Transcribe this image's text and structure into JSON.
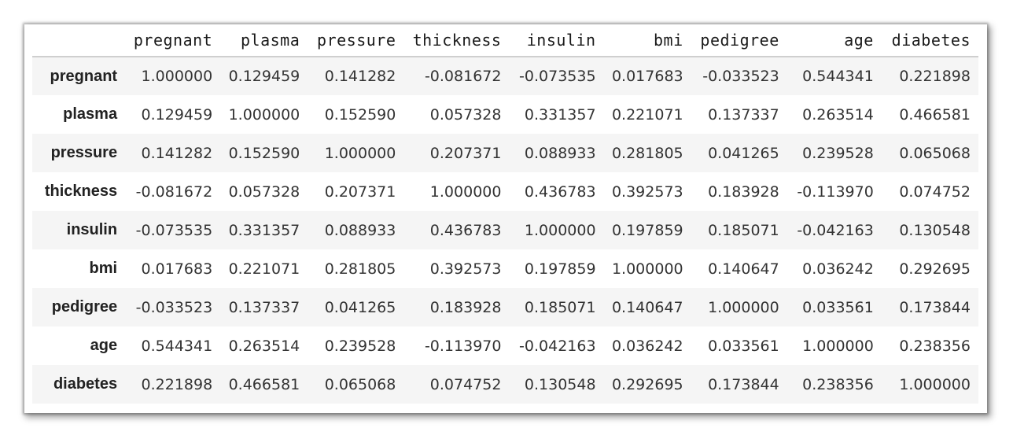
{
  "table": {
    "columns": [
      "pregnant",
      "plasma",
      "pressure",
      "thickness",
      "insulin",
      "bmi",
      "pedigree",
      "age",
      "diabetes"
    ],
    "rows": [
      {
        "label": "pregnant",
        "values": [
          "1.000000",
          "0.129459",
          "0.141282",
          "-0.081672",
          "-0.073535",
          "0.017683",
          "-0.033523",
          "0.544341",
          "0.221898"
        ]
      },
      {
        "label": "plasma",
        "values": [
          "0.129459",
          "1.000000",
          "0.152590",
          "0.057328",
          "0.331357",
          "0.221071",
          "0.137337",
          "0.263514",
          "0.466581"
        ]
      },
      {
        "label": "pressure",
        "values": [
          "0.141282",
          "0.152590",
          "1.000000",
          "0.207371",
          "0.088933",
          "0.281805",
          "0.041265",
          "0.239528",
          "0.065068"
        ]
      },
      {
        "label": "thickness",
        "values": [
          "-0.081672",
          "0.057328",
          "0.207371",
          "1.000000",
          "0.436783",
          "0.392573",
          "0.183928",
          "-0.113970",
          "0.074752"
        ]
      },
      {
        "label": "insulin",
        "values": [
          "-0.073535",
          "0.331357",
          "0.088933",
          "0.436783",
          "1.000000",
          "0.197859",
          "0.185071",
          "-0.042163",
          "0.130548"
        ]
      },
      {
        "label": "bmi",
        "values": [
          "0.017683",
          "0.221071",
          "0.281805",
          "0.392573",
          "0.197859",
          "1.000000",
          "0.140647",
          "0.036242",
          "0.292695"
        ]
      },
      {
        "label": "pedigree",
        "values": [
          "-0.033523",
          "0.137337",
          "0.041265",
          "0.183928",
          "0.185071",
          "0.140647",
          "1.000000",
          "0.033561",
          "0.173844"
        ]
      },
      {
        "label": "age",
        "values": [
          "0.544341",
          "0.263514",
          "0.239528",
          "-0.113970",
          "-0.042163",
          "0.036242",
          "0.033561",
          "1.000000",
          "0.238356"
        ]
      },
      {
        "label": "diabetes",
        "values": [
          "0.221898",
          "0.466581",
          "0.065068",
          "0.074752",
          "0.130548",
          "0.292695",
          "0.173844",
          "0.238356",
          "1.000000"
        ]
      }
    ]
  },
  "colors": {
    "row_stripe": "#f5f5f5",
    "header_rule": "#cfcfcf",
    "text": "#333333"
  }
}
